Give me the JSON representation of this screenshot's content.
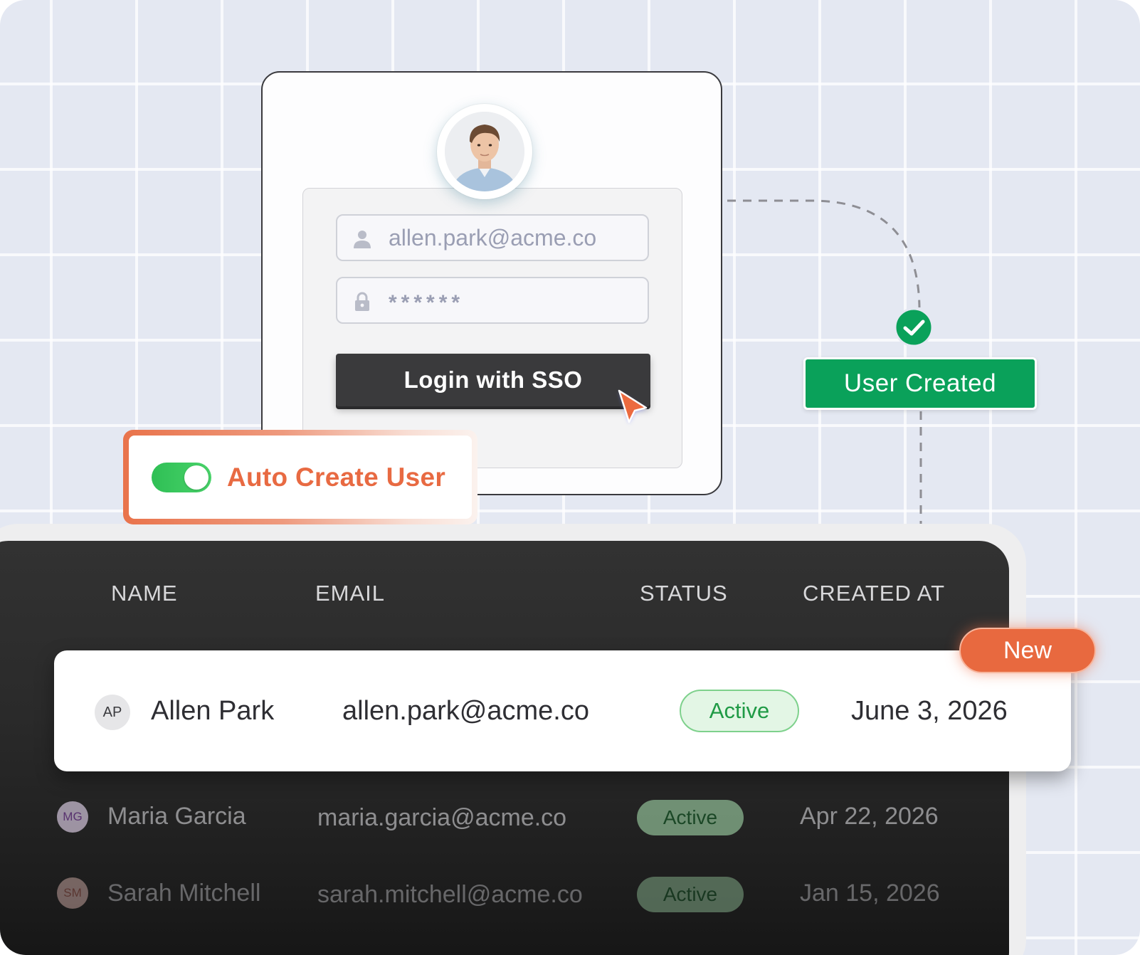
{
  "login": {
    "email_value": "allen.park@acme.co",
    "password_masked": "******",
    "sso_button_label": "Login with SSO"
  },
  "flow": {
    "status_label": "User Created"
  },
  "auto_create": {
    "label": "Auto Create User",
    "enabled": true
  },
  "table": {
    "headers": [
      "NAME",
      "EMAIL",
      "STATUS",
      "CREATED AT"
    ],
    "new_badge": "New",
    "rows": [
      {
        "initials": "AP",
        "name": "Allen Park",
        "email": "allen.park@acme.co",
        "status": "Active",
        "created_at": "June 3, 2026"
      },
      {
        "initials": "MG",
        "name": "Maria Garcia",
        "email": "maria.garcia@acme.co",
        "status": "Active",
        "created_at": "Apr 22, 2026"
      },
      {
        "initials": "SM",
        "name": "Sarah Mitchell",
        "email": "sarah.mitchell@acme.co",
        "status": "Active",
        "created_at": "Jan 15, 2026"
      }
    ]
  },
  "colors": {
    "accent_orange": "#e86a42",
    "success_green": "#0aa15a",
    "toggle_green": "#2fbf55",
    "button_dark": "#3a3a3c"
  },
  "icons": [
    "user-icon",
    "lock-icon",
    "cursor-icon",
    "check-circle-icon"
  ]
}
